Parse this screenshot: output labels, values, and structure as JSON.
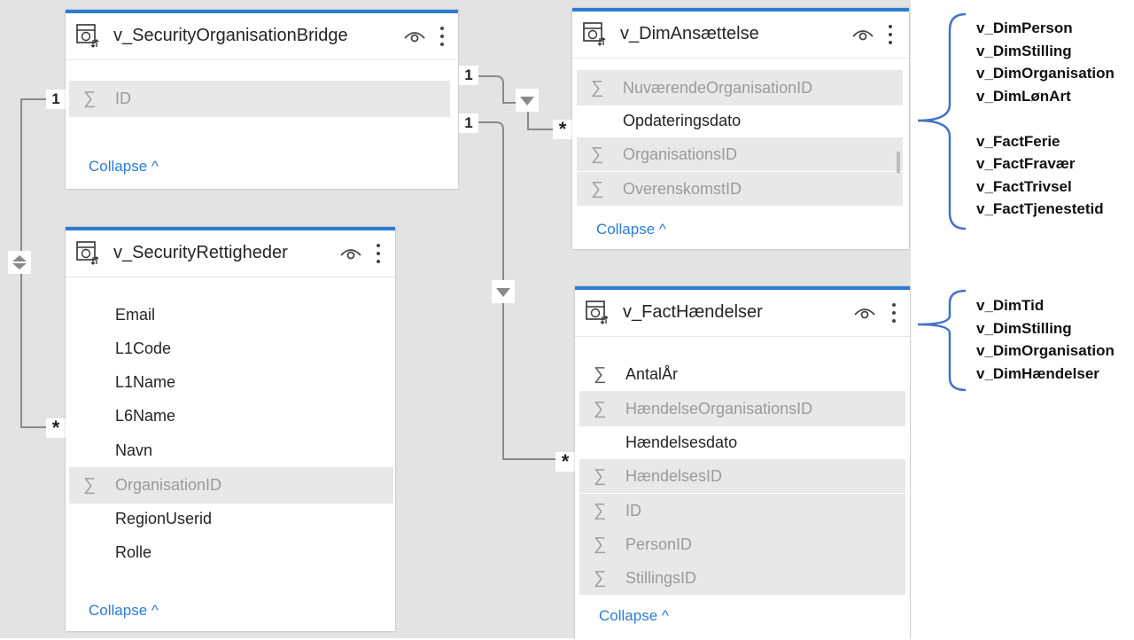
{
  "tables": {
    "bridge": {
      "title": "v_SecurityOrganisationBridge",
      "fields": [
        {
          "name": "ID",
          "sigma": "∑"
        }
      ],
      "collapse": "Collapse ^"
    },
    "rettigheder": {
      "title": "v_SecurityRettigheder",
      "fields": [
        {
          "name": "Email"
        },
        {
          "name": "L1Code"
        },
        {
          "name": "L1Name"
        },
        {
          "name": "L6Name"
        },
        {
          "name": "Navn"
        },
        {
          "name": "OrganisationID",
          "sigma": "∑"
        },
        {
          "name": "RegionUserid"
        },
        {
          "name": "Rolle"
        }
      ],
      "collapse": "Collapse ^"
    },
    "ansaettelse": {
      "title": "v_DimAnsættelse",
      "fields": [
        {
          "name": "NuværendeOrganisationID",
          "sigma": "∑"
        },
        {
          "name": "Opdateringsdato"
        },
        {
          "name": "OrganisationsID",
          "sigma": "∑"
        },
        {
          "name": "OverenskomstID",
          "sigma": "∑"
        }
      ],
      "collapse": "Collapse ^"
    },
    "haendelser": {
      "title": "v_FactHændelser",
      "fields": [
        {
          "name": "AntalÅr",
          "sigma": "∑"
        },
        {
          "name": "HændelseOrganisationsID",
          "sigma": "∑"
        },
        {
          "name": "Hændelsesdato"
        },
        {
          "name": "HændelsesID",
          "sigma": "∑"
        },
        {
          "name": "ID",
          "sigma": "∑"
        },
        {
          "name": "PersonID",
          "sigma": "∑"
        },
        {
          "name": "StillingsID",
          "sigma": "∑"
        }
      ],
      "collapse": "Collapse ^"
    }
  },
  "relationships": {
    "one": "1",
    "many": "*"
  },
  "annotations": {
    "group1": [
      "v_DimPerson",
      "v_DimStilling",
      "v_DimOrganisation",
      "v_DimLønArt",
      "",
      "v_FactFerie",
      "v_FactFravær",
      "v_FactTrivsel",
      "v_FactTjenestetid"
    ],
    "group2": [
      "v_DimTid",
      "v_DimStilling",
      "v_DimOrganisation",
      "v_DimHændelser"
    ]
  },
  "colors": {
    "accent": "#2b7cd3",
    "canvas": "#e3e3e3",
    "hidden_field_bg": "#e8e8e8",
    "brace": "#4472c4"
  },
  "icons": [
    "table-icon",
    "eye-icon",
    "more-options-icon",
    "sigma-icon",
    "filter-direction-icon",
    "bidirectional-filter-icon",
    "chevron-up-icon"
  ]
}
